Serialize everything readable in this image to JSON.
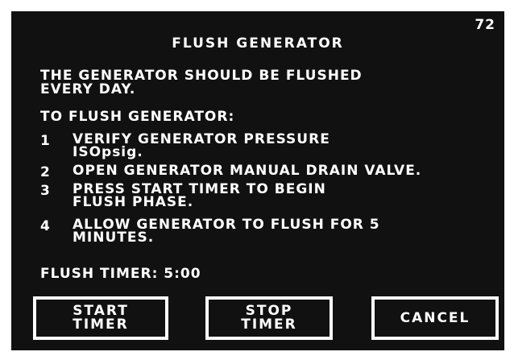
{
  "screen_number": "72",
  "title": "FLUSH GENERATOR",
  "intro": "THE GENERATOR SHOULD BE FLUSHED\nEVERY DAY.",
  "heading": "TO FLUSH GENERATOR:",
  "steps": [
    {
      "num": "1",
      "text": "VERIFY GENERATOR PRESSURE\nISOpsig."
    },
    {
      "num": "2",
      "text": "OPEN GENERATOR MANUAL DRAIN VALVE."
    },
    {
      "num": "3",
      "text": "PRESS START TIMER TO BEGIN\nFLUSH PHASE."
    },
    {
      "num": "4",
      "text": "ALLOW GENERATOR TO FLUSH FOR 5\nMINUTES."
    }
  ],
  "timer": {
    "label": "FLUSH TIMER:",
    "value": "5:00"
  },
  "buttons": {
    "start": "START\nTIMER",
    "stop": "STOP\nTIMER",
    "cancel": "CANCEL"
  },
  "colors": {
    "background": "#111111",
    "text": "#ffffff"
  }
}
